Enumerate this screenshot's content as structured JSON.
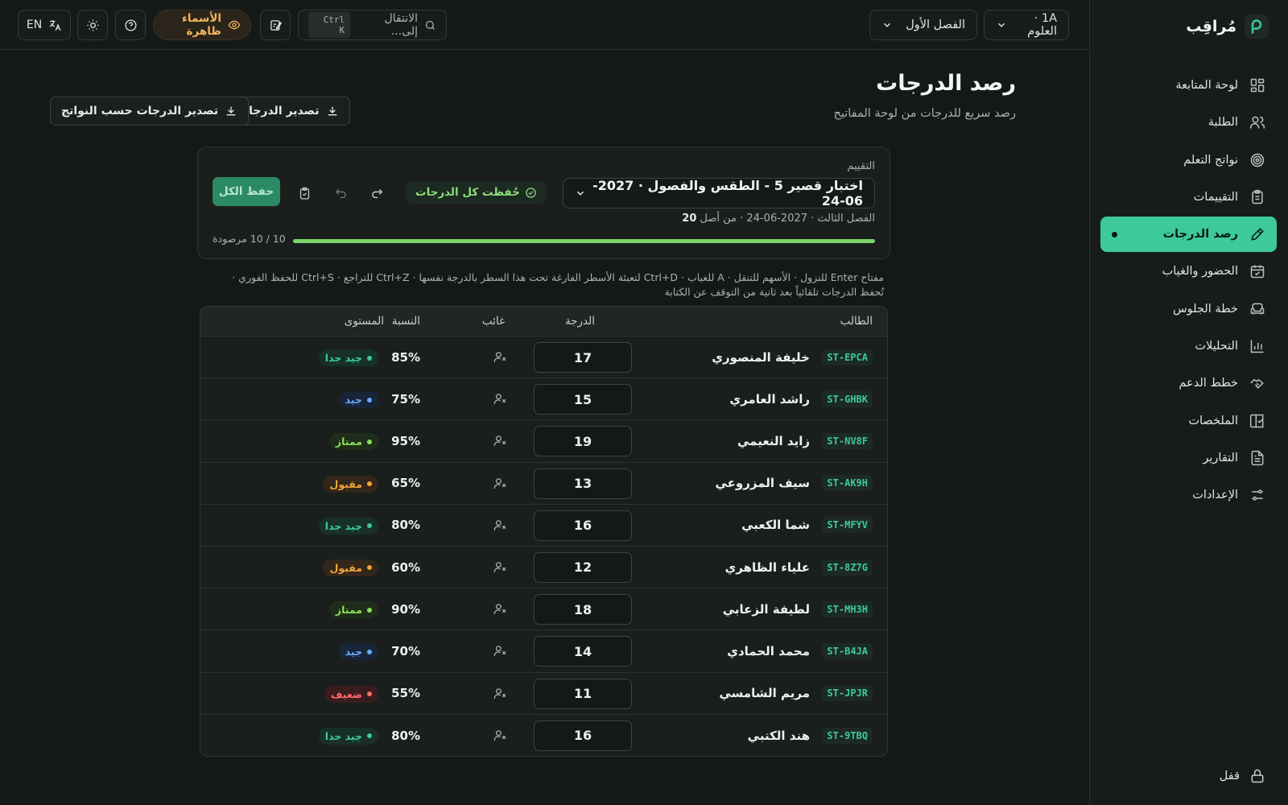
{
  "brand": {
    "name": "مُراقِب"
  },
  "sidebar": {
    "items": [
      {
        "label": "لوحة المتابعة",
        "icon": "dashboard-icon"
      },
      {
        "label": "الطلبة",
        "icon": "users-icon"
      },
      {
        "label": "نواتج التعلم",
        "icon": "target-icon"
      },
      {
        "label": "التقييمات",
        "icon": "clipboard-icon"
      },
      {
        "label": "رصد الدرجات",
        "icon": "pencil-icon",
        "active": true
      },
      {
        "label": "الحضور والغياب",
        "icon": "calendar-check-icon"
      },
      {
        "label": "خطة الجلوس",
        "icon": "armchair-icon"
      },
      {
        "label": "التحليلات",
        "icon": "bar-chart-icon"
      },
      {
        "label": "خطط الدعم",
        "icon": "handshake-icon"
      },
      {
        "label": "الملخصات",
        "icon": "book-check-icon"
      },
      {
        "label": "التقارير",
        "icon": "file-text-icon"
      },
      {
        "label": "الإعدادات",
        "icon": "sliders-icon"
      }
    ],
    "lock_label": "قفل"
  },
  "topbar": {
    "class_select": "1A · العلوم",
    "term_select": "الفصل الأول",
    "search_placeholder": "الانتقال إلى...",
    "search_shortcut": "Ctrl K",
    "names_visible": "الأسماء ظاهرة",
    "lang": "EN"
  },
  "header": {
    "title": "رصد الدرجات",
    "subtitle": "رصد سريع للدرجات من لوحة المفاتيح",
    "export_label": "تصدير الدرجات",
    "export_by_outcomes_label": "تصدير الدرجات حسب النواتج"
  },
  "assessment": {
    "label": "التقييم",
    "selected": "اختبار قصير 5 - الطقس والفصول · 2027-06-24",
    "meta_prefix": "الفصل الثالث · 2027-06-24 · من أصل",
    "max_score": "20",
    "saved_status": "حُفظت كل الدرجات",
    "save_all_label": "حفظ الكل",
    "progress": 1.0,
    "progress_text": "10 / 10 مرصودة"
  },
  "hint": "مفتاح Enter للنزول · الأسهم للتنقل · A للغياب · Ctrl+D لتعبئة الأسطر الفارغة تحت هذا السطر بالدرجة نفسها · Ctrl+Z للتراجع · Ctrl+S للحفظ الفوري · تُحفظ الدرجات تلقائياً بعد ثانية من التوقف عن الكتابة",
  "table": {
    "headers": {
      "student": "الطالب",
      "grade": "الدرجة",
      "absent": "غائب",
      "percent": "النسبة",
      "level": "المستوى"
    },
    "rows": [
      {
        "id": "ST-EPCA",
        "name": "خليفة المنصوري",
        "grade": "17",
        "percent": "85%",
        "level": "جيد جدا",
        "level_color": "#3ec99a",
        "level_bg": "#17302a"
      },
      {
        "id": "ST-GHBK",
        "name": "راشد العامري",
        "grade": "15",
        "percent": "75%",
        "level": "جيد",
        "level_color": "#6aa8ff",
        "level_bg": "#182538"
      },
      {
        "id": "ST-NV8F",
        "name": "زايد النعيمي",
        "grade": "19",
        "percent": "95%",
        "level": "ممتاز",
        "level_color": "#8fdc5a",
        "level_bg": "#1e2e1a"
      },
      {
        "id": "ST-AK9H",
        "name": "سيف المزروعي",
        "grade": "13",
        "percent": "65%",
        "level": "مقبول",
        "level_color": "#f0a43a",
        "level_bg": "#33261a"
      },
      {
        "id": "ST-MFYV",
        "name": "شما الكعبي",
        "grade": "16",
        "percent": "80%",
        "level": "جيد جدا",
        "level_color": "#3ec99a",
        "level_bg": "#17302a"
      },
      {
        "id": "ST-8Z7G",
        "name": "علياء الظاهري",
        "grade": "12",
        "percent": "60%",
        "level": "مقبول",
        "level_color": "#f0a43a",
        "level_bg": "#33261a"
      },
      {
        "id": "ST-MH3H",
        "name": "لطيفة الزعابي",
        "grade": "18",
        "percent": "90%",
        "level": "ممتاز",
        "level_color": "#8fdc5a",
        "level_bg": "#1e2e1a"
      },
      {
        "id": "ST-B4JA",
        "name": "محمد الحمادي",
        "grade": "14",
        "percent": "70%",
        "level": "جيد",
        "level_color": "#6aa8ff",
        "level_bg": "#182538"
      },
      {
        "id": "ST-JPJR",
        "name": "مريم الشامسي",
        "grade": "11",
        "percent": "55%",
        "level": "ضعيف",
        "level_color": "#ff6b6b",
        "level_bg": "#3a1c1f"
      },
      {
        "id": "ST-9TBQ",
        "name": "هند الكتبي",
        "grade": "16",
        "percent": "80%",
        "level": "جيد جدا",
        "level_color": "#3ec99a",
        "level_bg": "#17302a"
      }
    ]
  }
}
